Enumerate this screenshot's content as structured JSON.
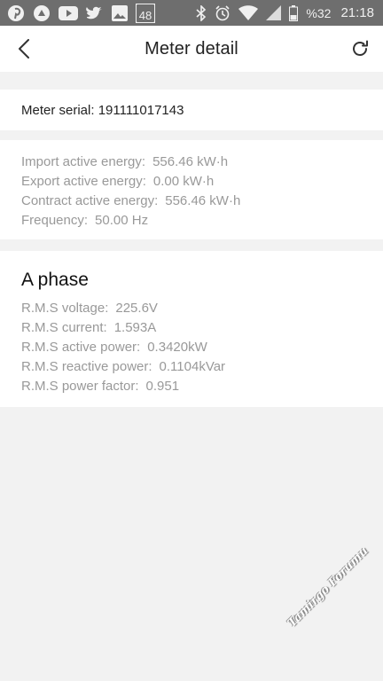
{
  "status_bar": {
    "battery": "%32",
    "time": "21:18",
    "notification_badge": "48",
    "icons_left": [
      "pinterest-icon",
      "app-icon",
      "youtube-icon",
      "twitter-icon",
      "gallery-icon",
      "badge-icon"
    ],
    "icons_right": [
      "bluetooth-icon",
      "alarm-icon",
      "wifi-icon",
      "signal-icon",
      "battery-icon"
    ]
  },
  "header": {
    "title": "Meter detail"
  },
  "serial": {
    "text": "Meter serial: 191111017143"
  },
  "energy": {
    "import_label": "Import active energy:",
    "import_value": "556.46 kW·h",
    "export_label": "Export active energy:",
    "export_value": "0.00 kW·h",
    "contract_label": "Contract active energy:",
    "contract_value": "556.46 kW·h",
    "frequency_label": "Frequency:",
    "frequency_value": "50.00 Hz"
  },
  "phase": {
    "title": "A phase",
    "voltage_label": "R.M.S voltage:",
    "voltage_value": "225.6V",
    "current_label": "R.M.S current:",
    "current_value": "1.593A",
    "active_power_label": "R.M.S active power:",
    "active_power_value": "0.3420kW",
    "reactive_power_label": "R.M.S reactive power:",
    "reactive_power_value": "0.1104kVar",
    "power_factor_label": "R.M.S power factor:",
    "power_factor_value": "0.951"
  },
  "watermark": {
    "text": "Tamirgo Forumu"
  },
  "colors": {
    "status_bar": "#6e6e6e",
    "page_bg": "#f2f2f2",
    "card_bg": "#ffffff",
    "muted_text": "#999999",
    "primary_text": "#222222"
  }
}
